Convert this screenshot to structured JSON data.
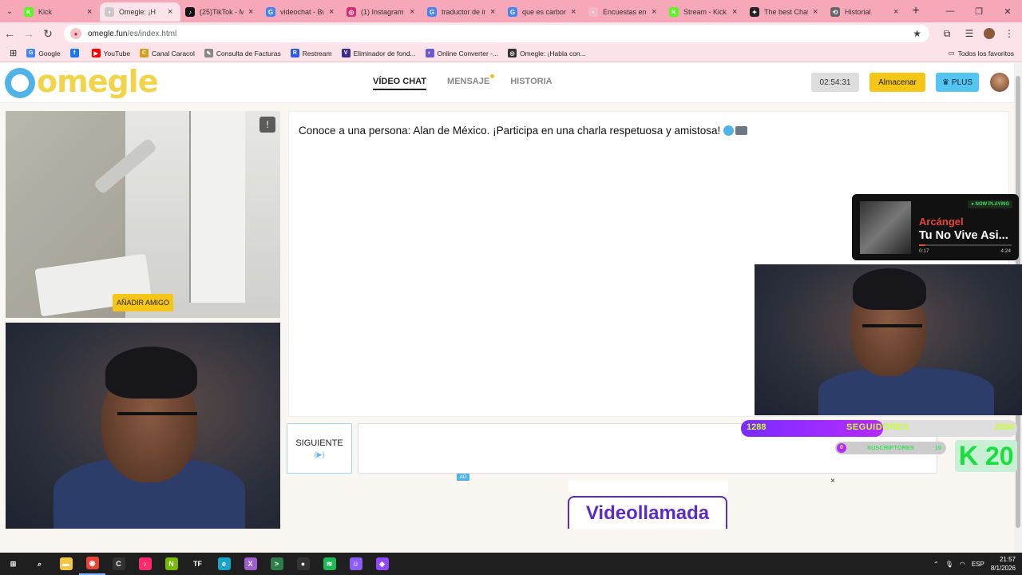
{
  "browser": {
    "tabs": [
      {
        "title": "Kick",
        "color": "#53fc18",
        "glyph": "K"
      },
      {
        "title": "Omegle: ¡H",
        "color": "#c9c9c9",
        "glyph": "•",
        "active": true
      },
      {
        "title": "(25)TikTok - M",
        "color": "#111111",
        "glyph": "♪"
      },
      {
        "title": "videochat - Bu",
        "color": "#4285f4",
        "glyph": "G"
      },
      {
        "title": "(1) Instagram",
        "color": "#d62976",
        "glyph": "◎"
      },
      {
        "title": "traductor de in",
        "color": "#4285f4",
        "glyph": "G"
      },
      {
        "title": "que es carbono",
        "color": "#4285f4",
        "glyph": "G"
      },
      {
        "title": "Encuestas en K",
        "color": "#f3b6c4",
        "glyph": "•"
      },
      {
        "title": "Stream - Kick M",
        "color": "#53fc18",
        "glyph": "K"
      },
      {
        "title": "The best ChatR",
        "color": "#222222",
        "glyph": "✦"
      },
      {
        "title": "Historial",
        "color": "#666666",
        "glyph": "⟲"
      }
    ],
    "url_domain": "omegle.fun",
    "url_path": "/es/index.html",
    "bookmarks": [
      {
        "label": "Google",
        "color": "#4285f4",
        "glyph": "G"
      },
      {
        "label": "",
        "color": "#1877f2",
        "glyph": "f"
      },
      {
        "label": "YouTube",
        "color": "#ff0000",
        "glyph": "▶"
      },
      {
        "label": "Canal Caracol",
        "color": "#d4a017",
        "glyph": "C"
      },
      {
        "label": "Consulta de Facturas",
        "color": "#888888",
        "glyph": "✎"
      },
      {
        "label": "Restream",
        "color": "#2f5bea",
        "glyph": "R"
      },
      {
        "label": "Eliminador de fond...",
        "color": "#3b2d8f",
        "glyph": "V"
      },
      {
        "label": "Online Converter -...",
        "color": "#6a5acd",
        "glyph": "◐"
      },
      {
        "label": "Omegle: ¡Habla con...",
        "color": "#333333",
        "glyph": "◎"
      }
    ],
    "all_bookmarks": "Todos los favoritos"
  },
  "header": {
    "logo_text": "omegle",
    "nav": {
      "video": "VÍDEO CHAT",
      "message": "MENSAJE",
      "history": "HISTORIA"
    },
    "timer": "02:54:31",
    "save": "Almacenar",
    "plus": "PLUS"
  },
  "video": {
    "add_friend": "AÑADIR AMIGO"
  },
  "chat": {
    "intro": "Conoce a una persona: Alan de México. ¡Participa en una charla respetuosa y amistosa!"
  },
  "controls": {
    "next": "SIGUIENTE",
    "next_hint": "(▶)"
  },
  "ad": {
    "badge": "AD",
    "title": "Videollamada",
    "close": "×"
  },
  "now_playing": {
    "tag": "● NOW PLAYING",
    "artist": "Arcángel",
    "song": "Tu No Vive Asi...",
    "elapsed": "0:17",
    "duration": "4:24",
    "progress": 0.065
  },
  "overlay": {
    "followers_count": "1288",
    "followers_label": "SEGUIDORES",
    "followers_goal": "2500",
    "followers_progress": 0.515,
    "subs_count": "0",
    "subs_label": "SUSCRIPTORES",
    "subs_goal": "10",
    "kick_number": "20"
  },
  "taskbar": {
    "apps": [
      {
        "name": "start",
        "color": "#1f1f1f",
        "glyph": "⊞"
      },
      {
        "name": "search",
        "color": "#1f1f1f",
        "glyph": "⌕"
      },
      {
        "name": "explorer",
        "color": "#f2c744",
        "glyph": "▬"
      },
      {
        "name": "chrome",
        "color": "#ea4335",
        "glyph": "◉"
      },
      {
        "name": "cod",
        "color": "#333333",
        "glyph": "C"
      },
      {
        "name": "tiktok",
        "color": "#ff2a6d",
        "glyph": "♪"
      },
      {
        "name": "nvidia",
        "color": "#76b900",
        "glyph": "N"
      },
      {
        "name": "tf",
        "color": "#1f1f1f",
        "glyph": "TF"
      },
      {
        "name": "edge",
        "color": "#1aa3c9",
        "glyph": "e"
      },
      {
        "name": "xbox",
        "color": "#a05fd1",
        "glyph": "X"
      },
      {
        "name": "terminal",
        "color": "#2d7d46",
        "glyph": ">"
      },
      {
        "name": "obs",
        "color": "#333333",
        "glyph": "●"
      },
      {
        "name": "spotify",
        "color": "#1db954",
        "glyph": "≋"
      },
      {
        "name": "discord",
        "color": "#8b5cf6",
        "glyph": "☺"
      },
      {
        "name": "twitch",
        "color": "#9146ff",
        "glyph": "◆"
      }
    ],
    "lang": "ESP",
    "time": "21:57",
    "date": "8/1/2026"
  }
}
